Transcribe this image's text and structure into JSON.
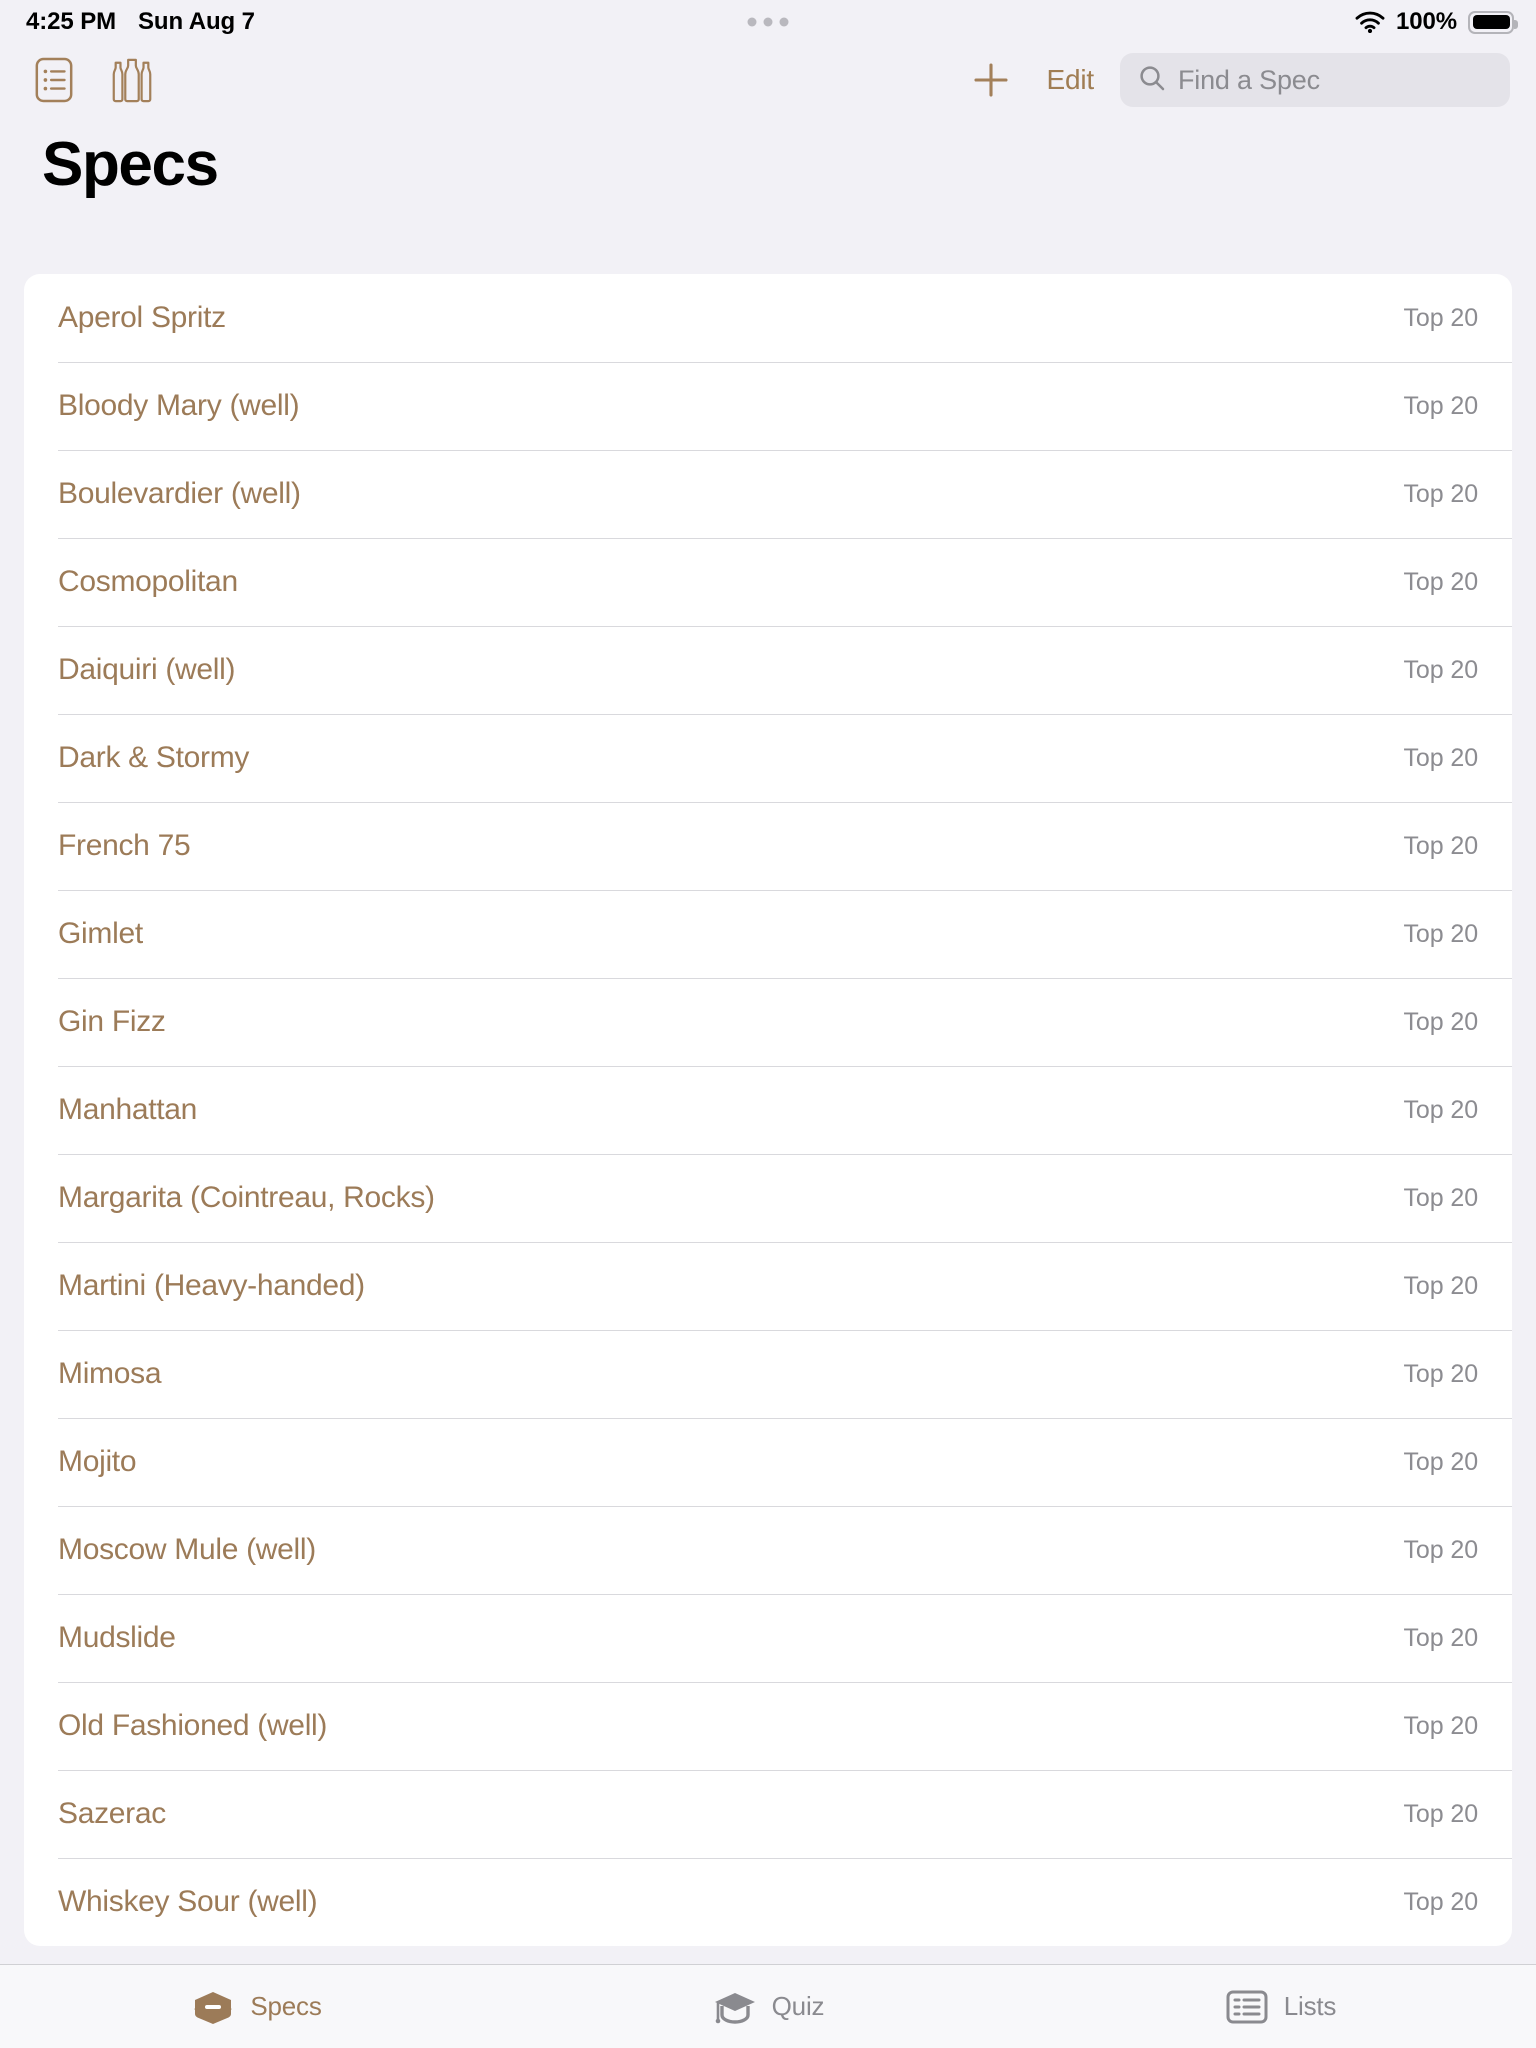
{
  "statusbar": {
    "time": "4:25 PM",
    "date": "Sun Aug 7",
    "battery_percent": "100%",
    "wifi_icon": "wifi-icon",
    "battery_icon": "battery-full-icon",
    "multitask_dots_icon": "multitasking-dots-icon"
  },
  "toolbar": {
    "notes_icon": "notes-list-icon",
    "bottles_icon": "bottles-icon",
    "add_icon": "plus-icon",
    "edit_label": "Edit",
    "search_icon": "search-icon",
    "search_placeholder": "Find a Spec",
    "search_value": ""
  },
  "page": {
    "title": "Specs"
  },
  "colors": {
    "accent_brown": "#9c7b58",
    "edit_brown": "#a07d53",
    "background": "#f2f1f6",
    "card": "#ffffff",
    "badge_gray": "#8c8c91",
    "separator": "#d9d9dd"
  },
  "list": {
    "rows": [
      {
        "name": "Aperol Spritz",
        "badge": "Top 20"
      },
      {
        "name": "Bloody Mary (well)",
        "badge": "Top 20"
      },
      {
        "name": "Boulevardier (well)",
        "badge": "Top 20"
      },
      {
        "name": "Cosmopolitan",
        "badge": "Top 20"
      },
      {
        "name": "Daiquiri (well)",
        "badge": "Top 20"
      },
      {
        "name": "Dark & Stormy",
        "badge": "Top 20"
      },
      {
        "name": "French 75",
        "badge": "Top 20"
      },
      {
        "name": "Gimlet",
        "badge": "Top 20"
      },
      {
        "name": "Gin Fizz",
        "badge": "Top 20"
      },
      {
        "name": "Manhattan",
        "badge": "Top 20"
      },
      {
        "name": "Margarita (Cointreau, Rocks)",
        "badge": "Top 20"
      },
      {
        "name": "Martini (Heavy-handed)",
        "badge": "Top 20"
      },
      {
        "name": "Mimosa",
        "badge": "Top 20"
      },
      {
        "name": "Mojito",
        "badge": "Top 20"
      },
      {
        "name": "Moscow Mule (well)",
        "badge": "Top 20"
      },
      {
        "name": "Mudslide",
        "badge": "Top 20"
      },
      {
        "name": "Old Fashioned (well)",
        "badge": "Top 20"
      },
      {
        "name": "Sazerac",
        "badge": "Top 20"
      },
      {
        "name": "Whiskey Sour (well)",
        "badge": "Top 20"
      }
    ]
  },
  "tabbar": {
    "tabs": [
      {
        "label": "Specs",
        "icon": "specs-box-icon",
        "active": true
      },
      {
        "label": "Quiz",
        "icon": "graduation-cap-icon",
        "active": false
      },
      {
        "label": "Lists",
        "icon": "lists-icon",
        "active": false
      }
    ]
  }
}
